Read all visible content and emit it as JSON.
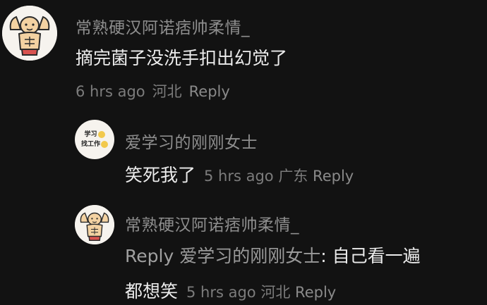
{
  "comments": [
    {
      "avatar_icon": "muscle-cartoon-avatar",
      "username": "常熟硬汉阿诺痞帅柔情_",
      "text": "摘完菌子没洗手扣出幻觉了",
      "time": "6 hrs ago",
      "location": "河北",
      "reply_label": "Reply"
    }
  ],
  "replies": [
    {
      "avatar_icon": "study-work-badge-avatar",
      "avatar_text_line1": "学习",
      "avatar_text_line2": "找工作",
      "username": "爱学习的刚刚女士",
      "text": "笑死我了",
      "time": "5 hrs ago",
      "location": "广东",
      "reply_label": "Reply"
    },
    {
      "avatar_icon": "muscle-cartoon-avatar",
      "username": "常熟硬汉阿诺痞帅柔情_",
      "reply_prefix": "Reply",
      "mention": "爱学习的刚刚女士",
      "text_line1": ": 自己看一遍",
      "text_line2": "都想笑",
      "time": "5 hrs ago",
      "location": "河北",
      "reply_label": "Reply"
    }
  ],
  "colors": {
    "background": "#121212",
    "username": "#8e8e8e",
    "text": "#ececec",
    "meta": "#7c7c7c"
  }
}
